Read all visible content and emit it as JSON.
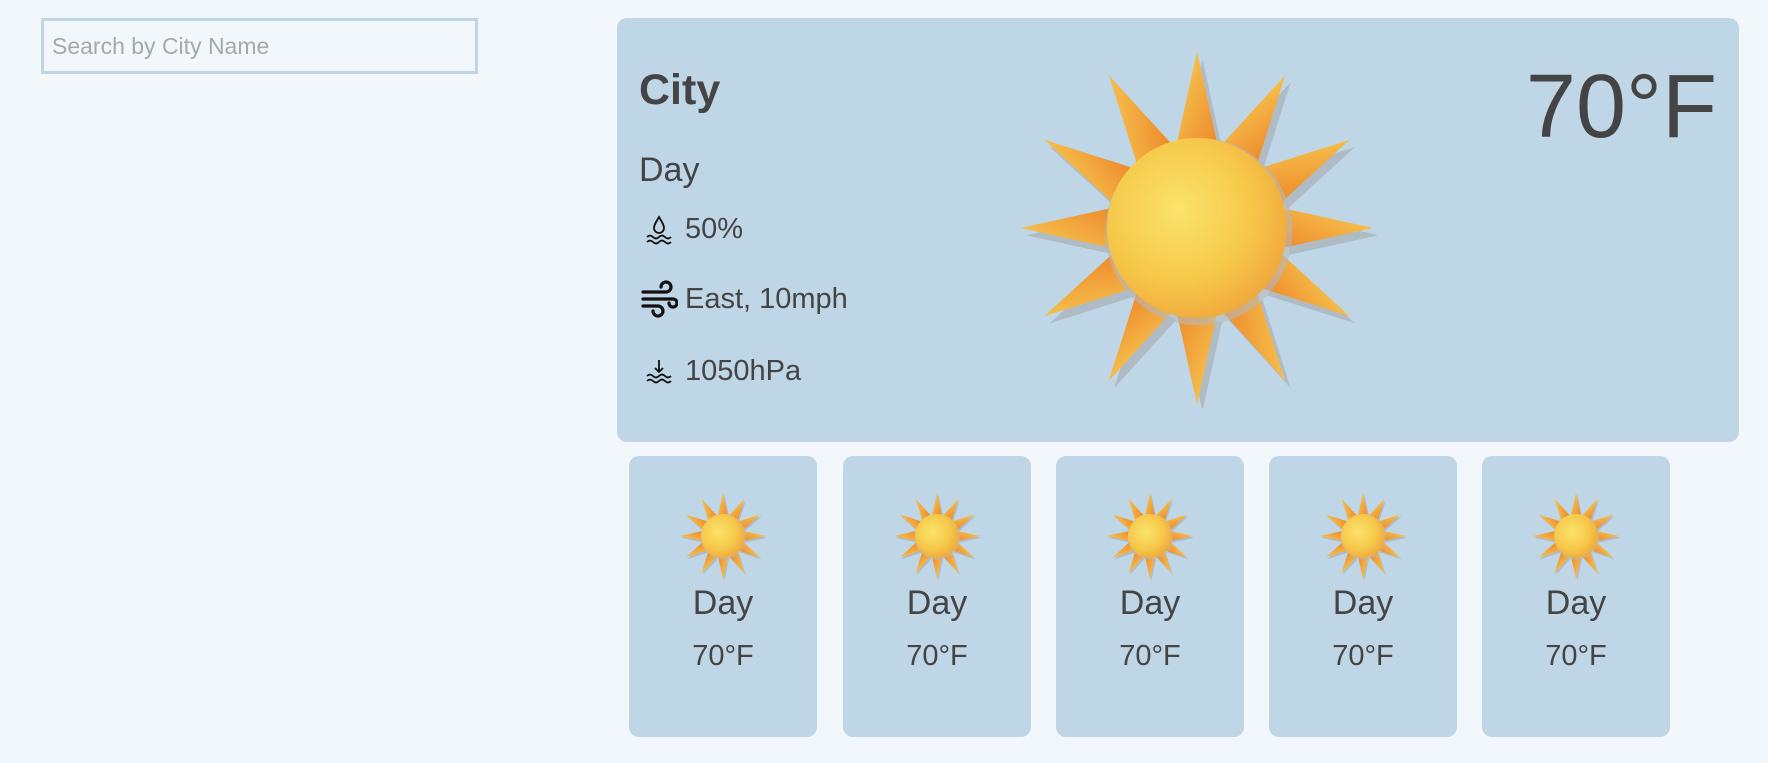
{
  "search": {
    "placeholder": "Search by City Name",
    "value": ""
  },
  "current": {
    "city": "City",
    "day": "Day",
    "humidity": "50%",
    "wind": "East, 10mph",
    "pressure": "1050hPa",
    "temperature": "70°F",
    "icon": "sun-icon"
  },
  "forecast": [
    {
      "day": "Day",
      "temperature": "70°F",
      "icon": "sun-icon"
    },
    {
      "day": "Day",
      "temperature": "70°F",
      "icon": "sun-icon"
    },
    {
      "day": "Day",
      "temperature": "70°F",
      "icon": "sun-icon"
    },
    {
      "day": "Day",
      "temperature": "70°F",
      "icon": "sun-icon"
    },
    {
      "day": "Day",
      "temperature": "70°F",
      "icon": "sun-icon"
    }
  ],
  "colors": {
    "background": "#f2f7fb",
    "card": "#bfd6e6",
    "text": "#444444",
    "sun_core": "#f6c94a",
    "sun_ray": "#f2a03a"
  }
}
